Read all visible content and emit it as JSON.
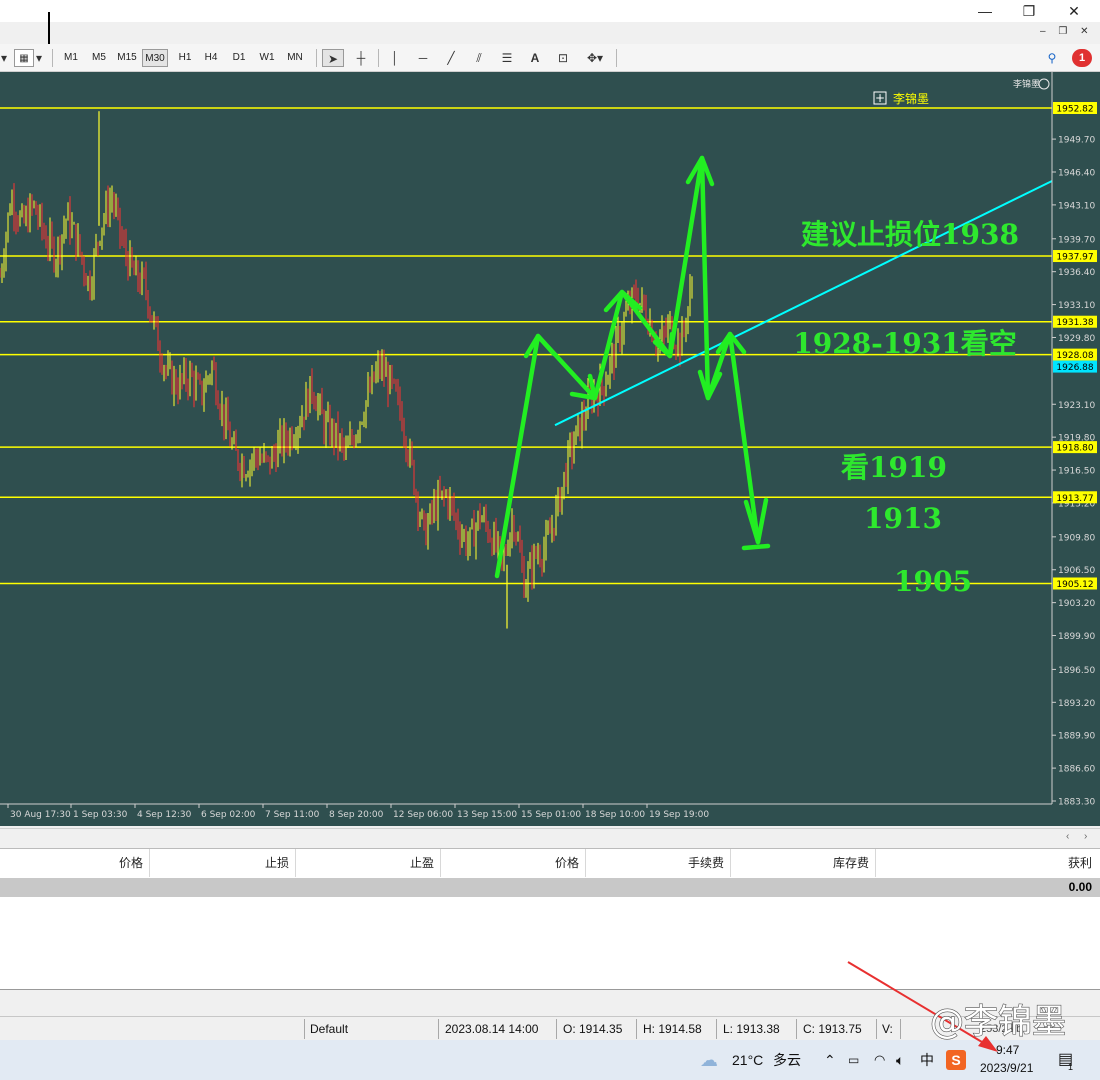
{
  "window": {
    "minimize_glyph": "—",
    "restore_glyph": "❐",
    "close_glyph": "✕",
    "mdi_min": "‒",
    "mdi_restore": "❐",
    "mdi_close": "✕"
  },
  "toolbar": {
    "timeframes": [
      "M1",
      "M5",
      "M15",
      "M30",
      "H1",
      "H4",
      "D1",
      "W1",
      "MN"
    ],
    "active_timeframe": "M30",
    "notification_count": "1"
  },
  "chart": {
    "watermark_name": "李锦墨",
    "legend_label": "李锦墨",
    "background": "#2f4f4f",
    "level_color": "#ffff00",
    "trendline_color": "#00ffff",
    "arrow_color": "#22ee22"
  },
  "chart_data": {
    "type": "line",
    "title": "",
    "ylim": [
      1883.3,
      1954.0
    ],
    "price_axis_ticks": [
      "1949.70",
      "1946.40",
      "1943.10",
      "1939.70",
      "1936.40",
      "1933.10",
      "1929.80",
      "1923.10",
      "1919.80",
      "1916.50",
      "1913.20",
      "1909.80",
      "1906.50",
      "1903.20",
      "1899.90",
      "1896.50",
      "1893.20",
      "1889.90",
      "1886.60",
      "1883.30"
    ],
    "time_axis_ticks": [
      "30 Aug 17:30",
      "1 Sep 03:30",
      "4 Sep 12:30",
      "6 Sep 02:00",
      "7 Sep 11:00",
      "8 Sep 20:00",
      "12 Sep 06:00",
      "13 Sep 15:00",
      "15 Sep 01:00",
      "18 Sep 10:00",
      "19 Sep 19:00"
    ],
    "horizontal_levels": [
      {
        "price": 1952.82,
        "label": "1952.82"
      },
      {
        "price": 1937.97,
        "label": "1937.97"
      },
      {
        "price": 1931.38,
        "label": "1931.38"
      },
      {
        "price": 1928.08,
        "label": "1928.08"
      },
      {
        "price": 1918.8,
        "label": "1918.80"
      },
      {
        "price": 1913.77,
        "label": "1913.77"
      },
      {
        "price": 1905.12,
        "label": "1905.12"
      }
    ],
    "current_price": {
      "price": 1926.88,
      "label": "1926.88"
    },
    "trendline": {
      "from_price": 1921.0,
      "to_price": 1945.5
    },
    "price_path": [
      1936,
      1944,
      1941,
      1943,
      1940,
      1938,
      1942,
      1939,
      1935,
      1941,
      1944,
      1939,
      1936,
      1935,
      1930,
      1926,
      1925,
      1926,
      1924,
      1927,
      1922,
      1918,
      1917,
      1918,
      1917,
      1919,
      1920,
      1922,
      1925,
      1921,
      1920,
      1918,
      1921,
      1924,
      1927,
      1925,
      1922,
      1916,
      1910,
      1913,
      1914,
      1911,
      1909,
      1912,
      1910,
      1907,
      1912,
      1905,
      1908,
      1909,
      1913,
      1918,
      1921,
      1924,
      1925,
      1928,
      1932,
      1934,
      1932,
      1929,
      1931,
      1929,
      1935
    ]
  },
  "annotations": {
    "stop_loss": "建议止损位1938",
    "short_zone": "1928-1931看空",
    "target_1": "看1919",
    "target_2": "1913",
    "target_3": "1905"
  },
  "terminal": {
    "columns": [
      "价格",
      "止损",
      "止盈",
      "价格",
      "手续费",
      "库存费",
      "获利"
    ],
    "total_profit": "0.00"
  },
  "statusbar": {
    "profile": "Default",
    "datetime": "2023.08.14 14:00",
    "open": "O: 1914.35",
    "high": "H: 1914.58",
    "low": "L: 1913.38",
    "close": "C: 1913.75",
    "volume": "V:",
    "traffic": "253/2 kb"
  },
  "taskbar": {
    "weather_temp": "21°C",
    "weather_desc": "多云",
    "ime": "中",
    "time": "9:47",
    "date": "2023/9/21",
    "notifications": "1"
  },
  "overlay": {
    "watermark": "@李锦墨"
  }
}
